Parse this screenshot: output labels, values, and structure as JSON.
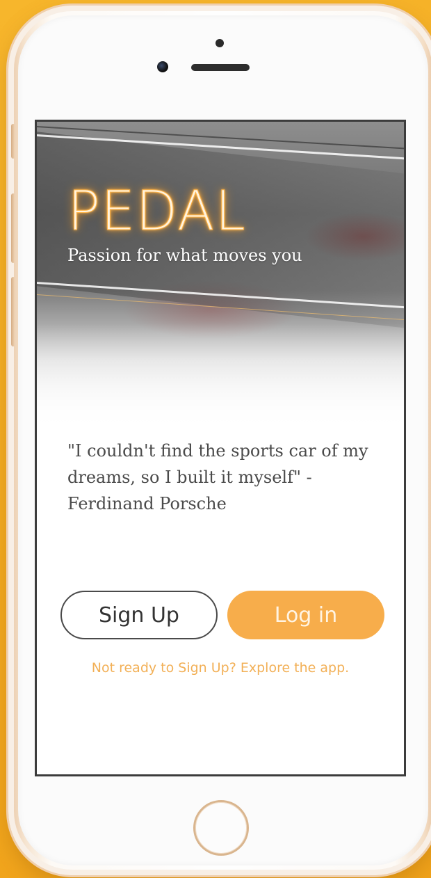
{
  "app": {
    "logo_text": "PEDAL",
    "tagline": "Passion for what moves you"
  },
  "quote": {
    "text": "\"I couldn't find the sports car of my dreams, so I built it myself\" - Ferdinand Porsche"
  },
  "actions": {
    "signup_label": "Sign Up",
    "login_label": "Log in",
    "explore_label": "Not ready to Sign Up? Explore the app."
  },
  "colors": {
    "background": "#f5b027",
    "accent": "#f7ad4b",
    "logo_glow": "#ff9a1a",
    "text": "#4a4a4a"
  },
  "icons": {
    "home_button": "home-button-icon",
    "camera": "camera-icon",
    "speaker": "speaker-icon"
  }
}
